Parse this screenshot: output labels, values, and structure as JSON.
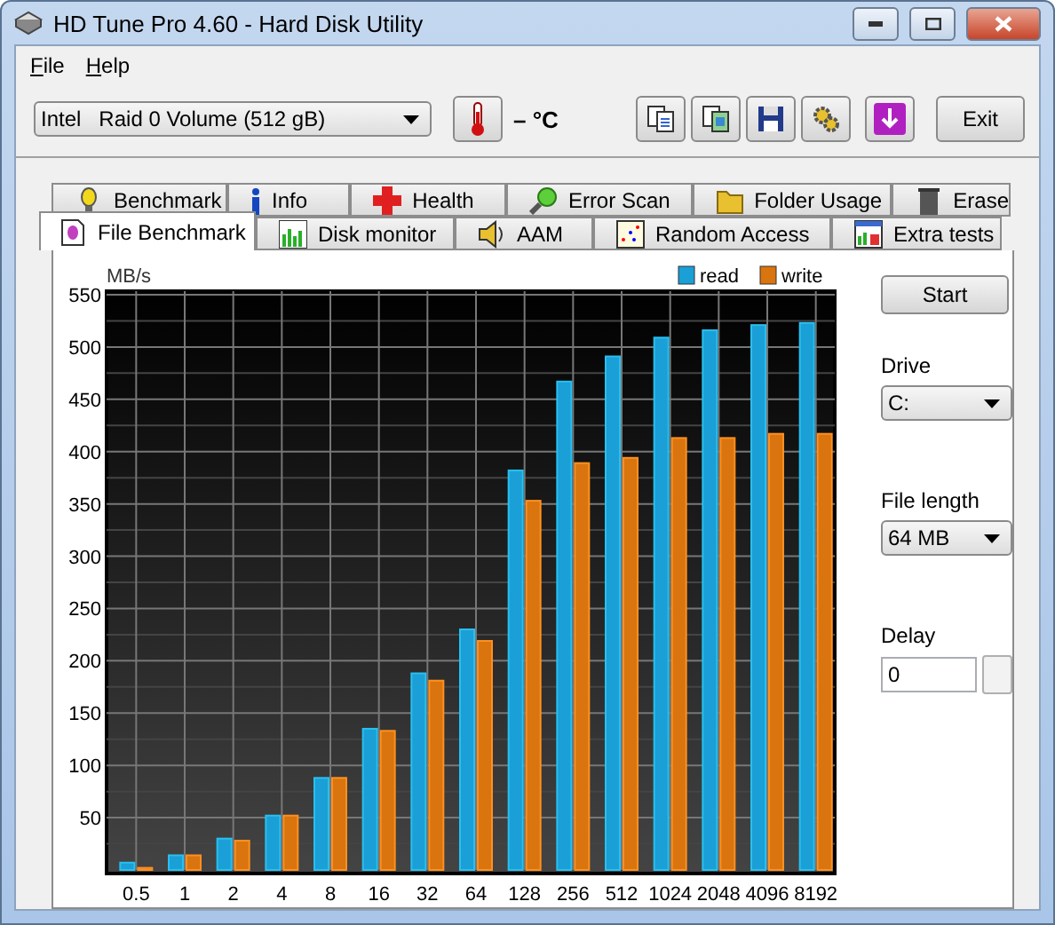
{
  "window": {
    "title": "HD Tune Pro 4.60 - Hard Disk Utility"
  },
  "menu": [
    {
      "label": "File"
    },
    {
      "label": "Help"
    }
  ],
  "toolbar": {
    "drive": "Intel   Raid 0 Volume (512 gB)",
    "temperature": "– °C",
    "exit": "Exit"
  },
  "tab_rows": [
    {
      "tabs": [
        {
          "label": "Benchmark",
          "kind": "benchmark",
          "selected": false
        },
        {
          "label": "Info",
          "kind": "info",
          "selected": false
        },
        {
          "label": "Health",
          "kind": "health",
          "selected": false
        },
        {
          "label": "Error Scan",
          "kind": "scan",
          "selected": false
        },
        {
          "label": "Folder Usage",
          "kind": "folder",
          "selected": false
        },
        {
          "label": "Erase",
          "kind": "erase",
          "selected": false
        }
      ]
    },
    {
      "tabs": [
        {
          "label": "File Benchmark",
          "kind": "file",
          "selected": true
        },
        {
          "label": "Disk monitor",
          "kind": "monitor",
          "selected": false
        },
        {
          "label": "AAM",
          "kind": "speaker",
          "selected": false
        },
        {
          "label": "Random Access",
          "kind": "random",
          "selected": false
        },
        {
          "label": "Extra tests",
          "kind": "extra",
          "selected": false
        }
      ]
    }
  ],
  "chart_data": {
    "type": "bar",
    "ylabel": "MB/s",
    "categories": [
      "0.5",
      "1",
      "2",
      "4",
      "8",
      "16",
      "32",
      "64",
      "128",
      "256",
      "512",
      "1024",
      "2048",
      "4096",
      "8192"
    ],
    "series": [
      {
        "name": "read",
        "color": "#1a9fd6",
        "values": [
          7,
          14,
          30,
          52,
          88,
          135,
          188,
          230,
          382,
          467,
          491,
          509,
          516,
          521,
          523
        ]
      },
      {
        "name": "write",
        "color": "#d9740e",
        "values": [
          2,
          14,
          28,
          52,
          88,
          133,
          181,
          219,
          353,
          389,
          394,
          413,
          413,
          417,
          417
        ]
      }
    ],
    "ylim": [
      0,
      550
    ],
    "grid": true,
    "yticks": [
      50,
      100,
      150,
      200,
      250,
      300,
      350,
      400,
      450,
      500,
      550
    ]
  },
  "side": {
    "start": "Start",
    "drive_label": "Drive",
    "drive": "C:",
    "length_label": "File length",
    "length": "64 MB",
    "delay_label": "Delay",
    "delay": "0"
  }
}
